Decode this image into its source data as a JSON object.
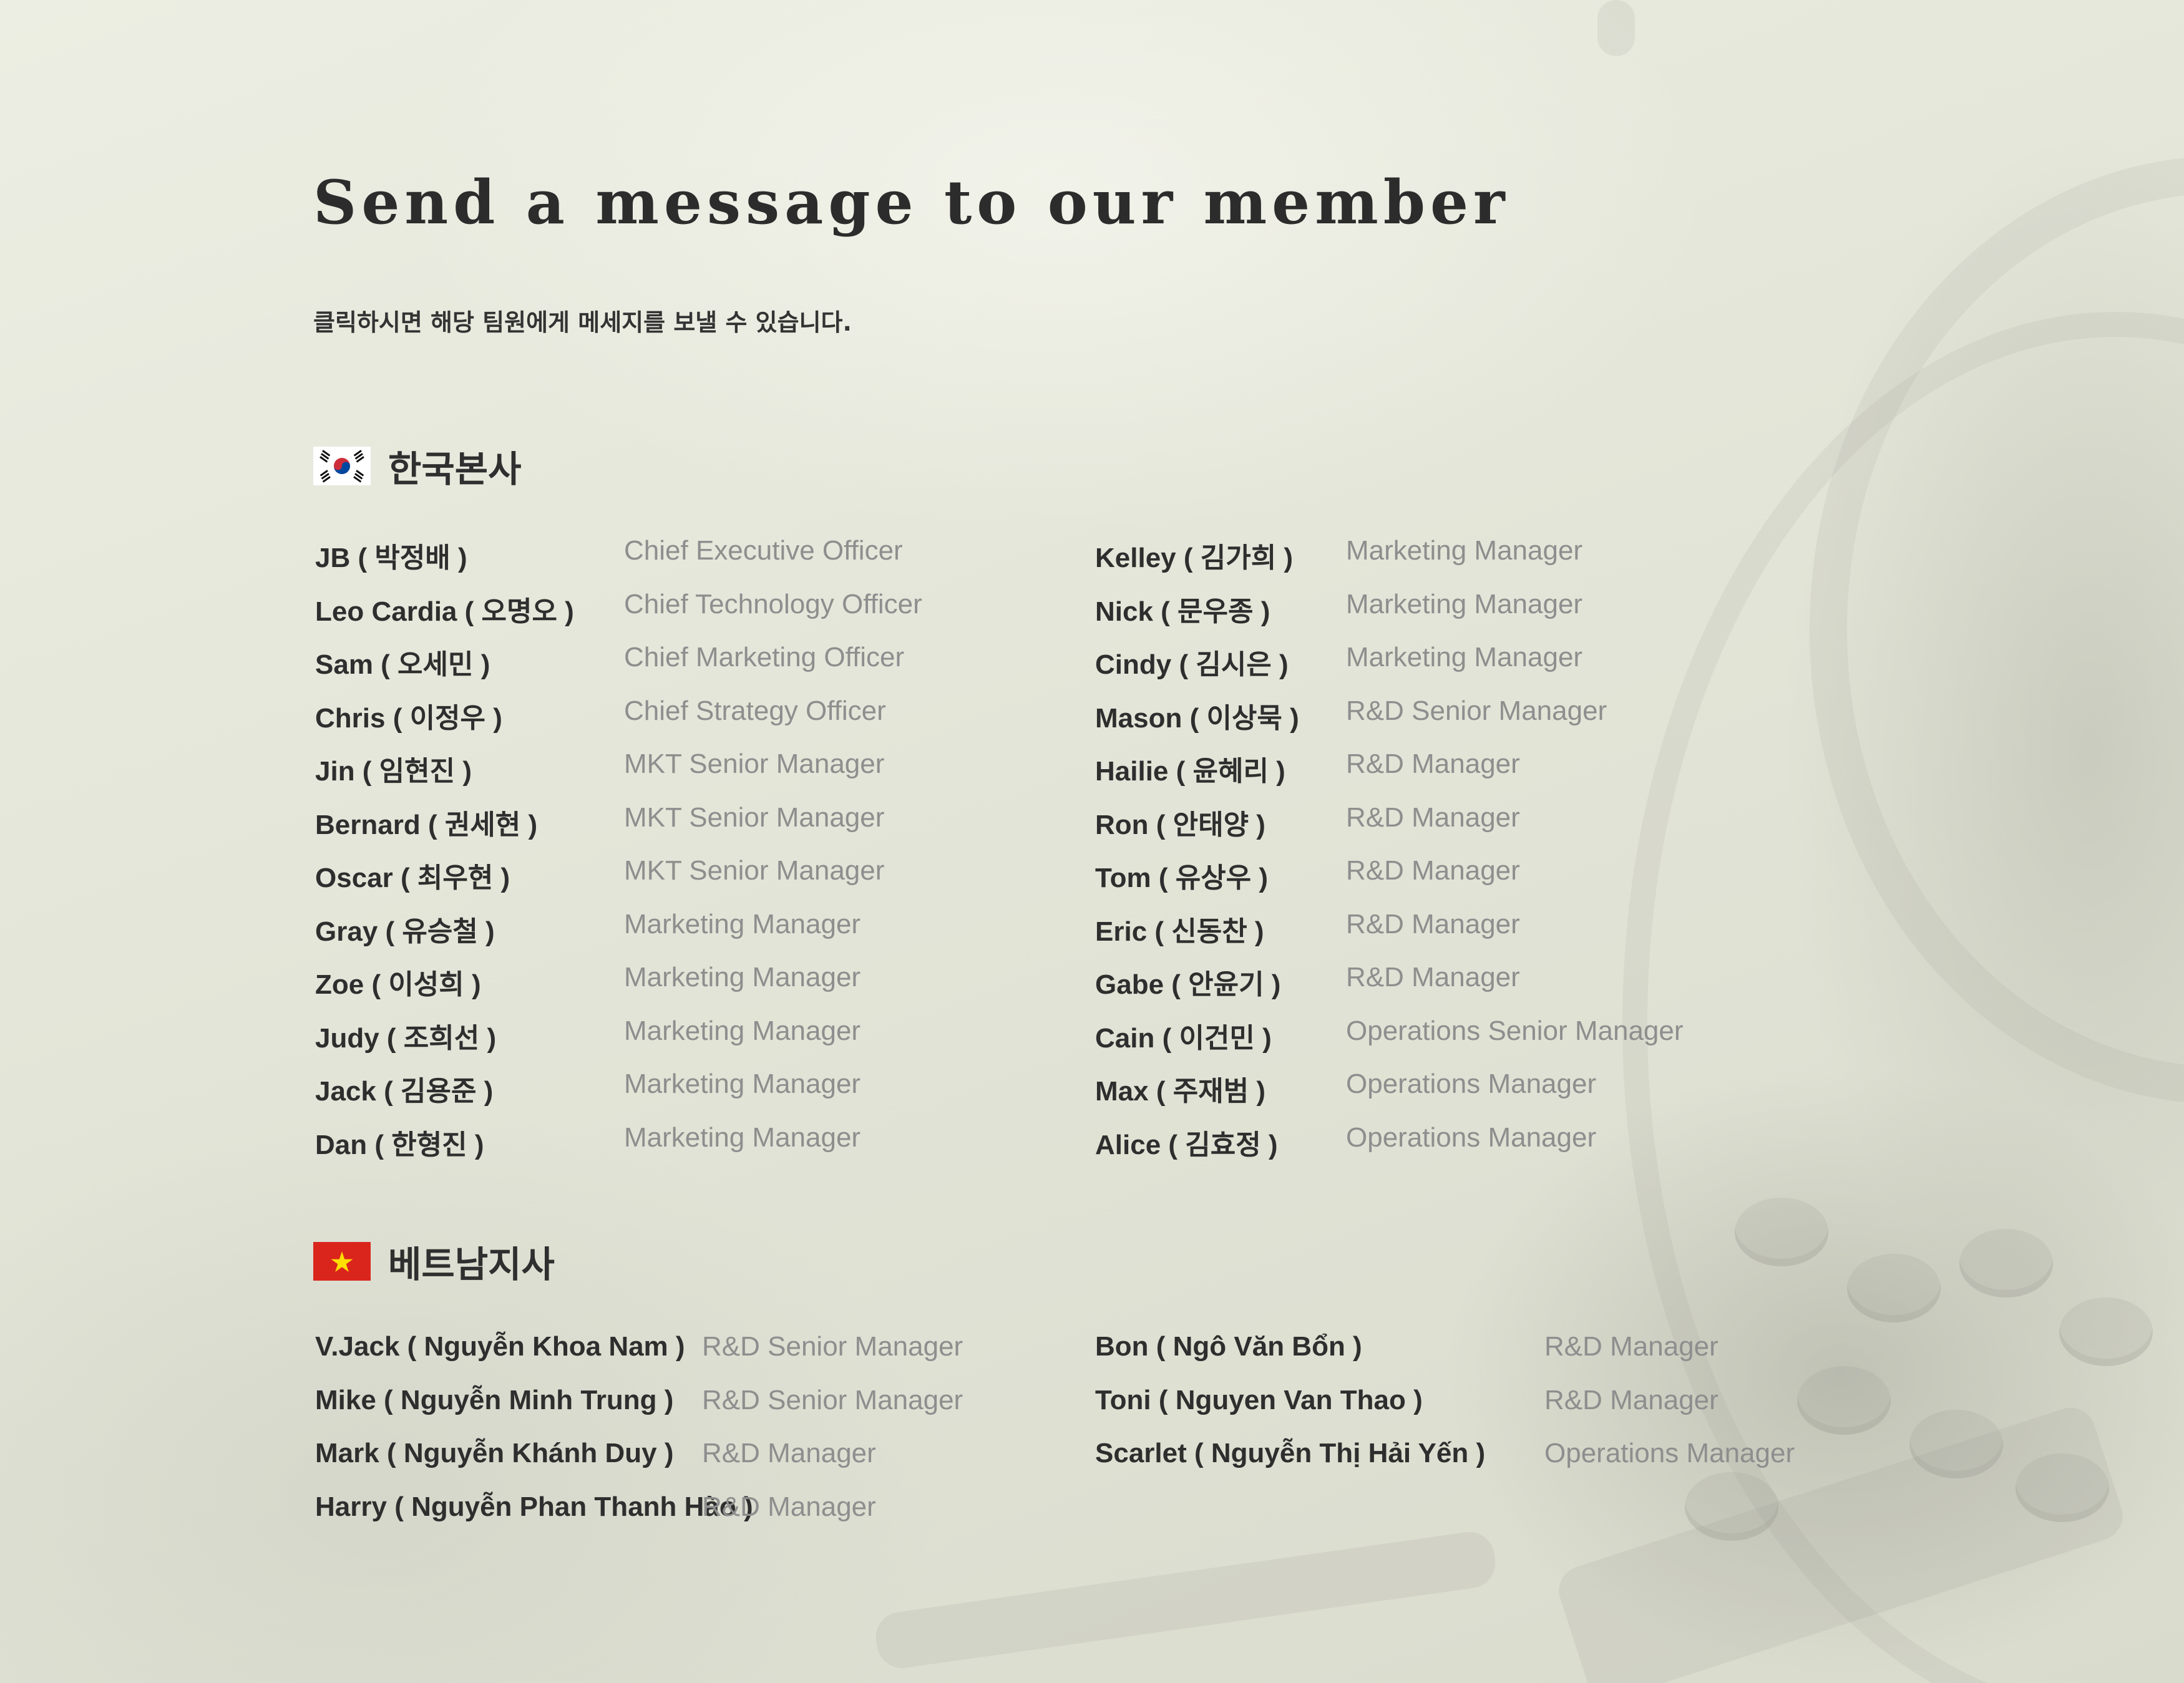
{
  "page": {
    "title": "Send a message to our member",
    "subtitle": "클릭하시면 해당 팀원에게 메세지를 보낼 수 있습니다."
  },
  "colors": {
    "background": "#e7e9dc",
    "name_text": "#2e2e2e",
    "role_text": "#8e8e8e",
    "vietnam_red": "#da251d",
    "vietnam_star": "#ffde00",
    "korea_red": "#cd2e3a",
    "korea_blue": "#0047a0"
  },
  "korea": {
    "label": "한국본사",
    "flag_icon": "south-korea-flag-icon",
    "left": [
      {
        "name": "JB ( 박정배 )",
        "role": "Chief Executive Officer"
      },
      {
        "name": "Leo Cardia ( 오명오 )",
        "role": "Chief Technology Officer"
      },
      {
        "name": "Sam ( 오세민 )",
        "role": "Chief Marketing Officer"
      },
      {
        "name": "Chris ( 이정우 )",
        "role": "Chief Strategy Officer"
      },
      {
        "name": "Jin ( 임현진 )",
        "role": "MKT Senior Manager"
      },
      {
        "name": "Bernard ( 권세현 )",
        "role": "MKT Senior Manager"
      },
      {
        "name": "Oscar ( 최우현 )",
        "role": "MKT Senior Manager"
      },
      {
        "name": "Gray ( 유승철 )",
        "role": "Marketing Manager"
      },
      {
        "name": "Zoe ( 이성희 )",
        "role": "Marketing Manager"
      },
      {
        "name": "Judy ( 조희선 )",
        "role": "Marketing Manager"
      },
      {
        "name": "Jack ( 김용준 )",
        "role": "Marketing Manager"
      },
      {
        "name": "Dan ( 한형진 )",
        "role": "Marketing Manager"
      }
    ],
    "right": [
      {
        "name": "Kelley ( 김가희 )",
        "role": "Marketing Manager"
      },
      {
        "name": "Nick ( 문우종 )",
        "role": "Marketing Manager"
      },
      {
        "name": "Cindy ( 김시은 )",
        "role": "Marketing Manager"
      },
      {
        "name": "Mason ( 이상묵 )",
        "role": "R&D Senior Manager"
      },
      {
        "name": "Hailie ( 윤혜리 )",
        "role": "R&D Manager"
      },
      {
        "name": "Ron ( 안태양 )",
        "role": "R&D Manager"
      },
      {
        "name": "Tom ( 유상우 )",
        "role": "R&D Manager"
      },
      {
        "name": "Eric ( 신동찬 )",
        "role": "R&D Manager"
      },
      {
        "name": "Gabe ( 안윤기 )",
        "role": "R&D Manager"
      },
      {
        "name": "Cain ( 이건민 )",
        "role": "Operations Senior Manager"
      },
      {
        "name": "Max ( 주재범 )",
        "role": "Operations Manager"
      },
      {
        "name": "Alice ( 김효정 )",
        "role": "Operations Manager"
      }
    ]
  },
  "vietnam": {
    "label": "베트남지사",
    "flag_icon": "vietnam-flag-icon",
    "left": [
      {
        "name": "V.Jack ( Nguyễn Khoa Nam )",
        "role": "R&D Senior Manager"
      },
      {
        "name": "Mike ( Nguyễn Minh Trung )",
        "role": "R&D Senior Manager"
      },
      {
        "name": "Mark ( Nguyễn Khánh Duy )",
        "role": "R&D Manager"
      },
      {
        "name": "Harry ( Nguyễn Phan Thanh Hào )",
        "role": "R&D Manager"
      }
    ],
    "right": [
      {
        "name": "Bon ( Ngô Văn Bổn )",
        "role": "R&D Manager"
      },
      {
        "name": "Toni ( Nguyen Van Thao )",
        "role": "R&D Manager"
      },
      {
        "name": "Scarlet ( Nguyễn Thị Hải Yến )",
        "role": "Operations Manager"
      }
    ]
  }
}
